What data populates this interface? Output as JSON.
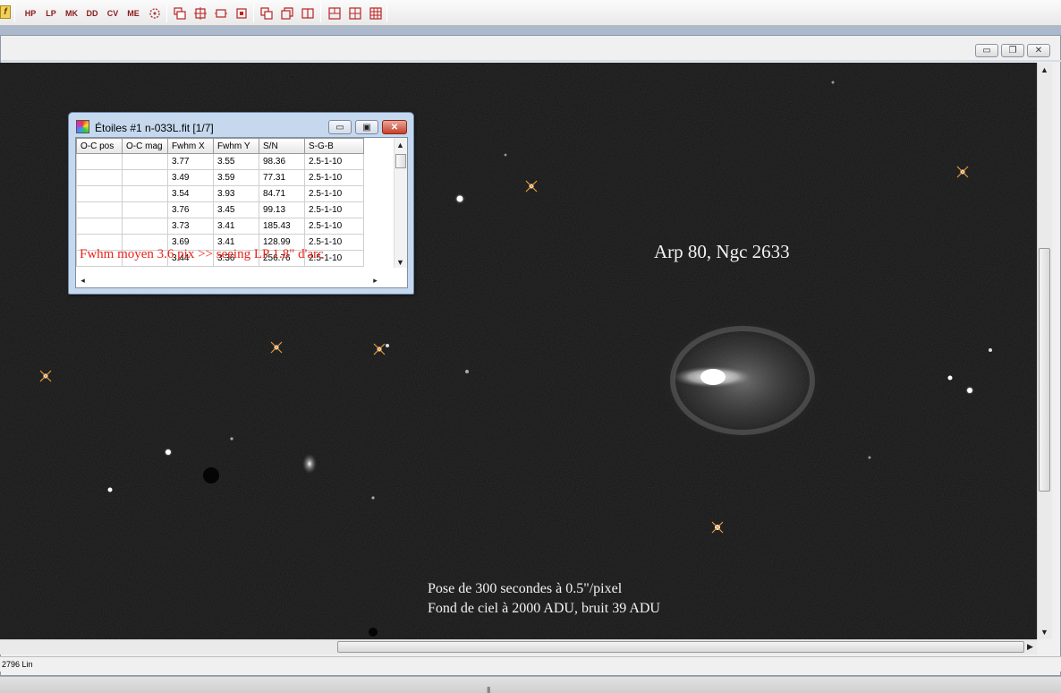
{
  "toolbar": {
    "text_buttons": [
      "HP",
      "LP",
      "MK",
      "DD",
      "CV",
      "ME"
    ],
    "f_label": "f",
    "icons": [
      "filter-icon",
      "window-cascade-icon",
      "window-tile-icon",
      "window-arrange-icon",
      "window-small-icon",
      "window-copy-icon",
      "window-restore-icon",
      "window-split-icon",
      "grid-2-icon",
      "grid-4-icon",
      "grid-6-icon"
    ]
  },
  "doc_window": {
    "minimize": "▭",
    "restore": "❐",
    "close": "✕"
  },
  "image": {
    "title": "Arp 80, Ngc 2633",
    "caption_line1": "Pose de 300 secondes à 0.5\"/pixel",
    "caption_line2": "Fond de ciel à 2000 ADU, bruit 39 ADU"
  },
  "status": {
    "text": "2796 Lin"
  },
  "stars_window": {
    "title": "Étoiles #1 n-033L.fit  [1/7]",
    "columns": [
      "O-C pos",
      "O-C mag",
      "Fwhm X",
      "Fwhm Y",
      "S/N",
      "S-G-B"
    ],
    "rows": [
      [
        "",
        "",
        "3.77",
        "3.55",
        "98.36",
        "2.5-1-10"
      ],
      [
        "",
        "",
        "3.49",
        "3.59",
        "77.31",
        "2.5-1-10"
      ],
      [
        "",
        "",
        "3.54",
        "3.93",
        "84.71",
        "2.5-1-10"
      ],
      [
        "",
        "",
        "3.76",
        "3.45",
        "99.13",
        "2.5-1-10"
      ],
      [
        "",
        "",
        "3.73",
        "3.41",
        "185.43",
        "2.5-1-10"
      ],
      [
        "",
        "",
        "3.69",
        "3.41",
        "128.99",
        "2.5-1-10"
      ],
      [
        "",
        "",
        "3.44",
        "3.36",
        "256.76",
        "2.5-1-10"
      ]
    ],
    "footer": "Fwhm moyen 3.6 pix  >> seeing LP 1.8\" d'arc",
    "btn_min": "▭",
    "btn_max": "▣",
    "btn_close": "✕"
  }
}
